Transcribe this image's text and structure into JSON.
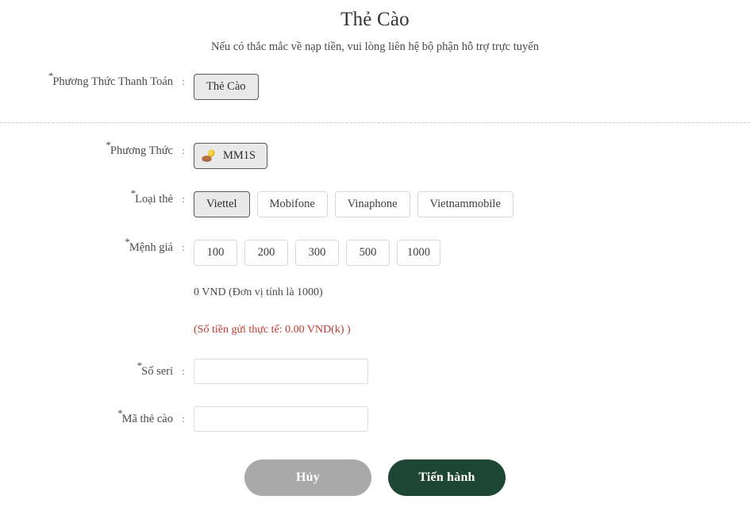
{
  "header": {
    "title": "Thẻ Cào",
    "subtitle": "Nếu có thắc mắc về nạp tiền, vui lòng liên hệ bộ phận hỗ trợ trực tuyến"
  },
  "required_marker": "*",
  "colon": ":",
  "rows": {
    "payment_method": {
      "label": "Phương Thức Thanh Toán",
      "options": [
        "Thẻ Cào"
      ],
      "selected": "Thẻ Cào"
    },
    "method": {
      "label": "Phương Thức",
      "icon": "coin-icon",
      "options": [
        "MM1S"
      ],
      "selected": "MM1S"
    },
    "card_type": {
      "label": "Loại thẻ",
      "options": [
        "Viettel",
        "Mobifone",
        "Vinaphone",
        "Vietnammobile"
      ],
      "selected": "Viettel"
    },
    "denomination": {
      "label": "Mệnh giá",
      "options": [
        "100",
        "200",
        "300",
        "500",
        "1000"
      ],
      "selected": null,
      "hint": "0 VND (Đơn vị tính là 1000)",
      "warning": "(Số tiền gửi thực tế: 0.00 VND(k) )"
    },
    "serial": {
      "label": "Số seri",
      "value": "",
      "placeholder": ""
    },
    "card_code": {
      "label": "Mã thẻ cào",
      "value": "",
      "placeholder": ""
    }
  },
  "actions": {
    "cancel_label": "Hủy",
    "submit_label": "Tiến hành"
  },
  "colors": {
    "submit_green": "#1e4634",
    "cancel_gray": "#a9a9a9",
    "warning_red": "#c0392b",
    "selected_fill": "#e9e9e9"
  }
}
